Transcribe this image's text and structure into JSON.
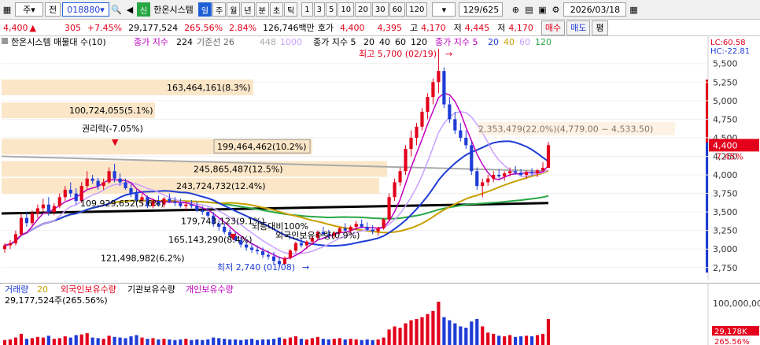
{
  "toolbar": {
    "tab_icon": "grid-icon",
    "market_select": "주",
    "sub_select": "전",
    "code_value": "018880",
    "company_badge": "신",
    "company_name": "한온시스템",
    "periods": [
      "일",
      "주",
      "월",
      "년",
      "분",
      "초",
      "틱"
    ],
    "intervals": [
      "1",
      "3",
      "5",
      "10",
      "20",
      "30",
      "60",
      "120"
    ],
    "count": "129/625",
    "date": "2026/03/18"
  },
  "infobar": {
    "price": "4,400",
    "change": "305",
    "change_pct": "+7.45%",
    "volume": "29,177,524",
    "volume_ratio": "265.56%",
    "turnover_pct": "2.84%",
    "amount": "126,746백만",
    "quote_label": "호가",
    "ask": "4,400",
    "bid": "4,395",
    "high_label": "고",
    "high": "4,170",
    "low_label": "저",
    "low_mid": "4,445",
    "low_end_label": "저",
    "low": "4,170",
    "buy_label": "매수",
    "sell_label": "매도",
    "flat_label": "평"
  },
  "main_legend": {
    "title": "한온시스템 매물대 수(10)",
    "cum": "종가 지수",
    "ma_a_label": "224",
    "ma_b_label": "기준선 26",
    "ma_c_label": "448",
    "ma_d_label": "1000",
    "ma_group_label": "종가 지수 5",
    "ma_periods": [
      "20",
      "40",
      "60",
      "120"
    ],
    "ma_group2_label": "종가 지수 5",
    "ma_periods2": [
      "20",
      "40",
      "60",
      "120"
    ]
  },
  "volume_legend": {
    "items": [
      "거래량",
      "20",
      "외국인보유수량",
      "기관보유수량",
      "개인보유수량"
    ],
    "value_text": "29,177,524주(265.56%)"
  },
  "chart_data": {
    "type": "candlestick",
    "y_ticks": [
      2750,
      3000,
      3250,
      3500,
      3750,
      4000,
      4250,
      4500,
      4750,
      5000,
      5250,
      5500
    ],
    "ylim": [
      2620,
      5720
    ],
    "indicators": {
      "lc": "LC:60.58",
      "hc": "HC:-22.81"
    },
    "current_price_label": "4,400",
    "current_pct_label": "7.45%",
    "max_label": "최고 5,700 (02/19)",
    "min_label": "최저 2,740 (01/08)",
    "rights_label": "권리락(-7.05%)",
    "volume_profile": [
      {
        "text": "163,464,161(8.3%)",
        "price": 5180
      },
      {
        "text": "100,724,055(5.1%)",
        "price": 4870
      },
      {
        "text": "199,464,462(10.2%)",
        "price": 4380
      },
      {
        "text": "245,865,487(12.5%)",
        "price": 4080
      },
      {
        "text": "243,724,732(12.4%)",
        "price": 3850
      },
      {
        "text": "2,353,479(22.0%)(4,779.00 ~ 4,533.50)",
        "price": 4620
      },
      {
        "text": "109,929,652(5.6%)",
        "price": 3620
      },
      {
        "text": "179,743,123(9.1%)",
        "price": 3380
      },
      {
        "text": "165,143,290(8.4%)",
        "price": 3130
      },
      {
        "text": "121,498,982(6.2%)",
        "price": 2880
      }
    ],
    "overlay_labels": [
      "뇌등대비100%",
      "외국인보유수량(0.9%)"
    ],
    "candles": [
      [
        3000,
        3080,
        2950,
        3050
      ],
      [
        3050,
        3120,
        3000,
        3080
      ],
      [
        3080,
        3250,
        3050,
        3200
      ],
      [
        3200,
        3480,
        3180,
        3420
      ],
      [
        3420,
        3500,
        3300,
        3350
      ],
      [
        3350,
        3520,
        3320,
        3480
      ],
      [
        3480,
        3600,
        3420,
        3550
      ],
      [
        3550,
        3680,
        3500,
        3600
      ],
      [
        3600,
        3700,
        3450,
        3500
      ],
      [
        3500,
        3620,
        3460,
        3580
      ],
      [
        3580,
        3750,
        3550,
        3700
      ],
      [
        3700,
        3850,
        3650,
        3800
      ],
      [
        3800,
        3900,
        3700,
        3750
      ],
      [
        3750,
        3820,
        3600,
        3650
      ],
      [
        3650,
        3900,
        3620,
        3850
      ],
      [
        3850,
        4050,
        3800,
        3950
      ],
      [
        3950,
        4000,
        3880,
        3920
      ],
      [
        3920,
        3960,
        3800,
        3850
      ],
      [
        3850,
        3950,
        3800,
        3900
      ],
      [
        3900,
        4100,
        3880,
        4050
      ],
      [
        4050,
        4150,
        3900,
        3950
      ],
      [
        3950,
        4020,
        3850,
        3900
      ],
      [
        3900,
        3950,
        3800,
        3820
      ],
      [
        3820,
        3880,
        3700,
        3750
      ],
      [
        3750,
        3800,
        3620,
        3650
      ],
      [
        3650,
        3750,
        3600,
        3700
      ],
      [
        3700,
        3720,
        3550,
        3580
      ],
      [
        3580,
        3680,
        3550,
        3650
      ],
      [
        3650,
        3720,
        3580,
        3600
      ],
      [
        3600,
        3700,
        3560,
        3680
      ],
      [
        3680,
        3750,
        3620,
        3640
      ],
      [
        3640,
        3700,
        3580,
        3620
      ],
      [
        3620,
        3680,
        3560,
        3580
      ],
      [
        3580,
        3640,
        3520,
        3600
      ],
      [
        3600,
        3660,
        3550,
        3580
      ],
      [
        3580,
        3640,
        3500,
        3520
      ],
      [
        3520,
        3580,
        3460,
        3500
      ],
      [
        3500,
        3560,
        3420,
        3450
      ],
      [
        3450,
        3500,
        3300,
        3340
      ],
      [
        3340,
        3400,
        3250,
        3300
      ],
      [
        3300,
        3350,
        3200,
        3230
      ],
      [
        3230,
        3280,
        3150,
        3180
      ],
      [
        3180,
        3230,
        3100,
        3120
      ],
      [
        3120,
        3160,
        3020,
        3060
      ],
      [
        3060,
        3120,
        2980,
        3020
      ],
      [
        3020,
        3080,
        2950,
        2990
      ],
      [
        2990,
        3050,
        2930,
        2970
      ],
      [
        2970,
        3020,
        2880,
        2920
      ],
      [
        2920,
        2980,
        2860,
        2900
      ],
      [
        2900,
        2960,
        2800,
        2840
      ],
      [
        2840,
        2900,
        2740,
        2800
      ],
      [
        2800,
        2900,
        2780,
        2880
      ],
      [
        2880,
        3000,
        2860,
        2980
      ],
      [
        2980,
        3100,
        2950,
        3080
      ],
      [
        3080,
        3150,
        3020,
        3050
      ],
      [
        3050,
        3120,
        3000,
        3100
      ],
      [
        3100,
        3180,
        3060,
        3150
      ],
      [
        3150,
        3250,
        3120,
        3230
      ],
      [
        3230,
        3300,
        3180,
        3200
      ],
      [
        3200,
        3260,
        3150,
        3180
      ],
      [
        3180,
        3240,
        3140,
        3220
      ],
      [
        3220,
        3300,
        3200,
        3280
      ],
      [
        3280,
        3350,
        3230,
        3250
      ],
      [
        3250,
        3320,
        3200,
        3300
      ],
      [
        3300,
        3380,
        3260,
        3340
      ],
      [
        3340,
        3400,
        3280,
        3300
      ],
      [
        3300,
        3360,
        3240,
        3260
      ],
      [
        3260,
        3320,
        3200,
        3240
      ],
      [
        3240,
        3300,
        3180,
        3280
      ],
      [
        3280,
        3420,
        3260,
        3400
      ],
      [
        3400,
        3750,
        3380,
        3700
      ],
      [
        3700,
        3950,
        3650,
        3900
      ],
      [
        3900,
        4100,
        3850,
        4050
      ],
      [
        4050,
        4400,
        4000,
        4350
      ],
      [
        4350,
        4600,
        4250,
        4500
      ],
      [
        4500,
        4700,
        4400,
        4650
      ],
      [
        4650,
        4900,
        4600,
        4850
      ],
      [
        4850,
        5100,
        4750,
        5050
      ],
      [
        5050,
        5300,
        4950,
        5250
      ],
      [
        5250,
        5700,
        5100,
        5400
      ],
      [
        5400,
        5450,
        4900,
        4950
      ],
      [
        4950,
        5050,
        4700,
        4750
      ],
      [
        4750,
        4850,
        4550,
        4600
      ],
      [
        4600,
        4700,
        4450,
        4500
      ],
      [
        4500,
        4600,
        4350,
        4400
      ],
      [
        4400,
        4450,
        4000,
        4050
      ],
      [
        4050,
        4100,
        3800,
        3850
      ],
      [
        3850,
        3950,
        3700,
        3900
      ],
      [
        3900,
        4000,
        3850,
        3950
      ],
      [
        3950,
        4050,
        3900,
        4000
      ],
      [
        4000,
        4080,
        3950,
        3980
      ],
      [
        3980,
        4050,
        3920,
        4020
      ],
      [
        4020,
        4100,
        3980,
        4050
      ],
      [
        4050,
        4120,
        4000,
        4030
      ],
      [
        4030,
        4080,
        3980,
        4000
      ],
      [
        4000,
        4060,
        3950,
        4040
      ],
      [
        4040,
        4090,
        3990,
        4020
      ],
      [
        4020,
        4080,
        3970,
        4060
      ],
      [
        4060,
        4170,
        4040,
        4095
      ],
      [
        4095,
        4445,
        4170,
        4400
      ]
    ],
    "volume": [
      8,
      9,
      12,
      18,
      10,
      11,
      13,
      12,
      15,
      10,
      11,
      14,
      12,
      16,
      17,
      19,
      12,
      11,
      10,
      15,
      13,
      12,
      11,
      14,
      16,
      12,
      10,
      11,
      9,
      10,
      9,
      8,
      9,
      10,
      8,
      9,
      8,
      9,
      12,
      11,
      10,
      9,
      9,
      8,
      9,
      10,
      8,
      9,
      9,
      10,
      12,
      10,
      12,
      14,
      10,
      9,
      11,
      13,
      10,
      9,
      10,
      11,
      9,
      10,
      9,
      8,
      9,
      8,
      9,
      12,
      25,
      30,
      28,
      35,
      40,
      42,
      45,
      50,
      55,
      70,
      45,
      40,
      35,
      30,
      28,
      38,
      42,
      30,
      20,
      18,
      15,
      14,
      16,
      13,
      14,
      15,
      14,
      16,
      18,
      42
    ]
  }
}
